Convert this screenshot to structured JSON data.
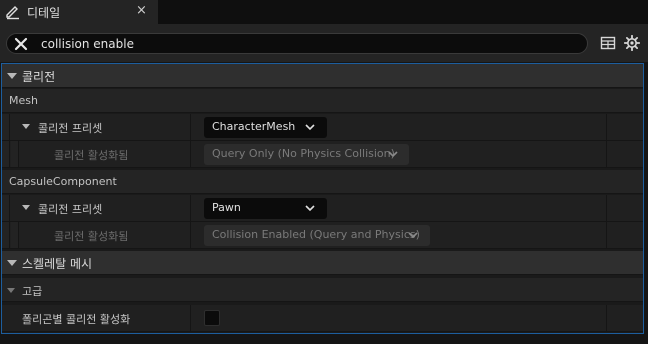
{
  "tab": {
    "title": "디테일",
    "icon": "pencil-icon",
    "close_label": "×"
  },
  "search": {
    "value": "collision enable",
    "clear_icon": "close-icon"
  },
  "toolbar": {
    "icons": [
      "table-icon",
      "gear-icon"
    ]
  },
  "panel": {
    "categories": [
      {
        "label": "콜리전"
      },
      {
        "label": "스켈레탈 메시"
      }
    ],
    "subsections": [
      {
        "label": "Mesh"
      },
      {
        "label": "CapsuleComponent"
      },
      {
        "label": "고급"
      }
    ],
    "properties": {
      "mesh_preset": {
        "label": "콜리전 프리셋",
        "value": "CharacterMesh"
      },
      "mesh_enabled": {
        "label": "콜리전 활성화됨",
        "value": "Query Only (No Physics Collision)"
      },
      "capsule_preset": {
        "label": "콜리전 프리셋",
        "value": "Pawn"
      },
      "capsule_enabled": {
        "label": "콜리전 활성화됨",
        "value": "Collision Enabled (Query and Physics)"
      },
      "per_poly": {
        "label": "폴리곤별 콜리전 활성화",
        "checked": false
      }
    }
  },
  "colors": {
    "accent_border": "#1d5e9e",
    "background": "#151515",
    "category": "#2f2f2f"
  }
}
